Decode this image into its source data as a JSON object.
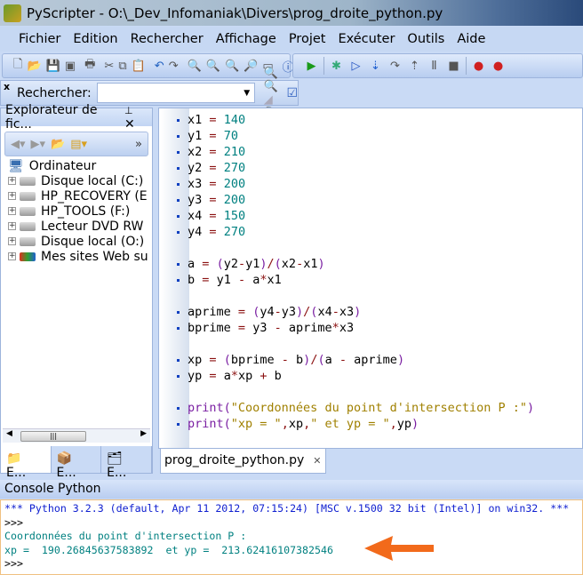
{
  "window": {
    "title": "PyScripter - O:\\_Dev_Infomaniak\\Divers\\prog_droite_python.py"
  },
  "menu": [
    "Fichier",
    "Edition",
    "Rechercher",
    "Affichage",
    "Projet",
    "Exécuter",
    "Outils",
    "Aide"
  ],
  "toolbar1": [
    "new-file",
    "open",
    "save",
    "save-all",
    "print",
    "cut",
    "copy",
    "paste",
    "undo",
    "redo",
    "find",
    "find-next",
    "replace",
    "find-in-files",
    "goto",
    "info"
  ],
  "toolbar2": [
    "run",
    "debug",
    "run-to-cursor",
    "step-into",
    "step-over",
    "step-out",
    "pause",
    "stop",
    "breakpoint",
    "clear-breakpoints"
  ],
  "search": {
    "label": "Rechercher:",
    "value": "",
    "placeholder": ""
  },
  "explorer": {
    "title": "Explorateur de fic...",
    "pin": "ᵖ",
    "close": "✕",
    "items": [
      {
        "label": "Ordinateur",
        "root": true
      },
      {
        "label": "Disque local (C:)"
      },
      {
        "label": "HP_RECOVERY (E"
      },
      {
        "label": "HP_TOOLS (F:)"
      },
      {
        "label": "Lecteur DVD RW"
      },
      {
        "label": "Disque local (O:)"
      },
      {
        "label": "Mes sites Web su"
      }
    ],
    "tabs": [
      "E...",
      "E...",
      "E..."
    ]
  },
  "editor": {
    "tab": "prog_droite_python.py",
    "lines": [
      "x1 = 140",
      "y1 = 70",
      "x2 = 210",
      "y2 = 270",
      "x3 = 200",
      "y3 = 200",
      "x4 = 150",
      "y4 = 270",
      "",
      "a = (y2-y1)/(x2-x1)",
      "b = y1 - a*x1",
      "",
      "aprime = (y4-y3)/(x4-x3)",
      "bprime = y3 - aprime*x3",
      "",
      "xp = (bprime - b)/(a - aprime)",
      "yp = a*xp + b",
      "",
      "print(\"Coordonnées du point d'intersection P :\")",
      "print(\"xp = \",xp,\" et yp = \",yp)"
    ]
  },
  "console": {
    "title": "Console Python",
    "lines": [
      {
        "text": "*** Python 3.2.3 (default, Apr 11 2012, 07:15:24) [MSC v.1500 32 bit (Intel)] on win32. ***",
        "color": "blue"
      },
      {
        "text": ">>>",
        "color": "black"
      },
      {
        "text": "Coordonnées du point d'intersection P :",
        "color": "teal"
      },
      {
        "text": "xp =  190.26845637583892  et yp =  213.62416107382546",
        "color": "teal"
      },
      {
        "text": ">>>",
        "color": "black"
      }
    ]
  },
  "colors": {
    "arrow": "#f26a1b",
    "accent": "#c9daf5"
  }
}
